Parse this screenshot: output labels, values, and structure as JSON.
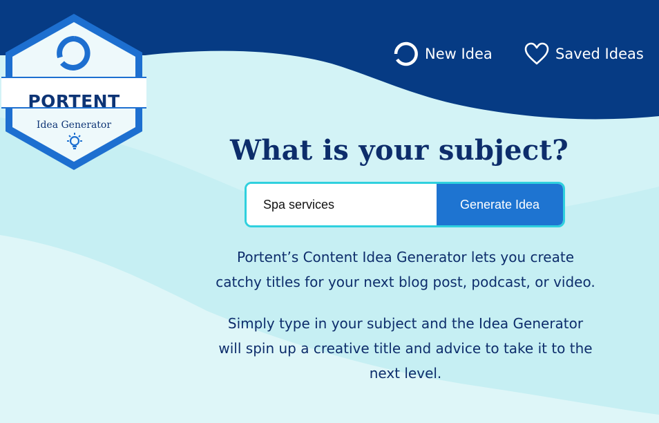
{
  "logo": {
    "brand": "PORTENT",
    "subtitle": "Idea Generator"
  },
  "nav": {
    "new_idea": "New Idea",
    "saved_ideas": "Saved Ideas"
  },
  "main": {
    "title": "What is your subject?",
    "search": {
      "value": "Spa services",
      "button": "Generate Idea"
    },
    "description": [
      [
        "Portent’s Content Idea Generator lets you create",
        "catchy titles for your next blog post, podcast, or video."
      ],
      [
        "Simply type in your subject and the Idea Generator",
        "will spin up a creative title and advice to take it to the",
        "next level."
      ]
    ]
  },
  "colors": {
    "header_navy": "#063b84",
    "accent_blue": "#1e74d1",
    "input_border": "#2fd0de",
    "text_dark": "#0d2d6b"
  },
  "icons": {
    "logo_mark": "portent-ring-icon",
    "bulb": "lightbulb-icon",
    "new_idea": "refresh-ring-icon",
    "saved": "heart-outline-icon"
  }
}
